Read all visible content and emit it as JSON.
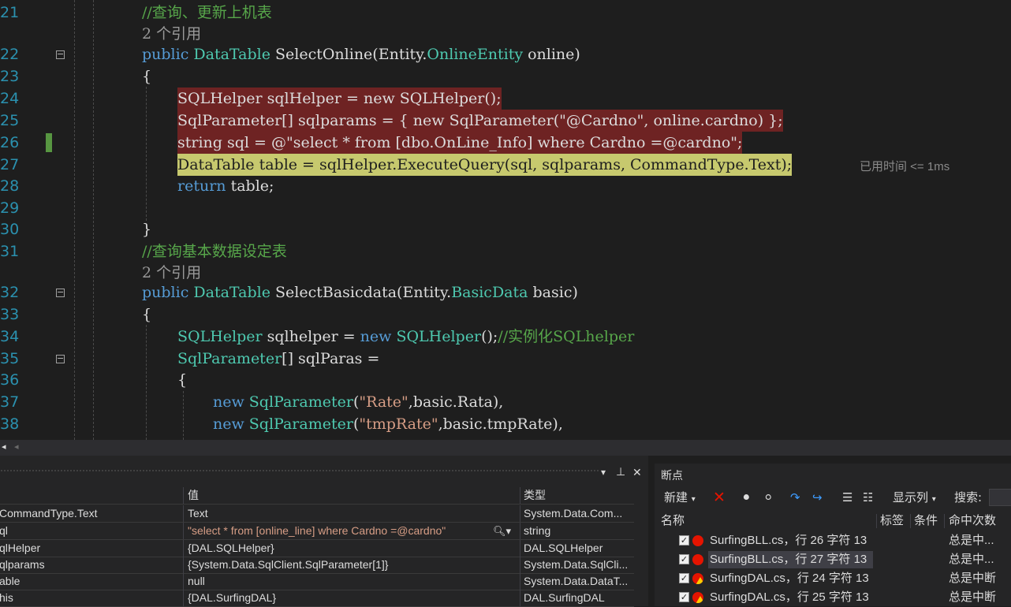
{
  "editor": {
    "lines": [
      {
        "n": "21"
      },
      {
        "n": "22"
      },
      {
        "n": "23"
      },
      {
        "n": "24"
      },
      {
        "n": "25"
      },
      {
        "n": "26"
      },
      {
        "n": "27"
      },
      {
        "n": "28"
      },
      {
        "n": "29"
      },
      {
        "n": "30"
      },
      {
        "n": "31"
      },
      {
        "n": "32"
      },
      {
        "n": "33"
      },
      {
        "n": "34"
      },
      {
        "n": "35"
      },
      {
        "n": "36"
      },
      {
        "n": "37"
      },
      {
        "n": "38"
      }
    ],
    "comment_21": "//查询、更新上机表",
    "refs_1": "2 个引用",
    "sig1": {
      "public": "public",
      "type": "DataTable",
      "name": " SelectOnline(Entity.",
      "param_type": "OnlineEntity",
      "param": " online)"
    },
    "brace_open": "{",
    "brace_close": "}",
    "l24": "SQLHelper sqlHelper = new SQLHelper();",
    "l25": "SqlParameter[] sqlparams = { new SqlParameter(\"@Cardno\", online.cardno) };",
    "l26": "string sql = @\"select * from [dbo.OnLine_Info] where Cardno =@cardno\";",
    "l27": "DataTable table = sqlHelper.ExecuteQuery(sql, sqlparams, CommandType.Text);",
    "elapsed": "已用时间 <= 1ms",
    "l28_kw": "return",
    "l28_rest": " table;",
    "comment_31": "//查询基本数据设定表",
    "refs_2": "2 个引用",
    "sig2": {
      "public": "public",
      "type": "DataTable",
      "name": " SelectBasicdata(Entity.",
      "param_type": "BasicData",
      "param": " basic)"
    },
    "l34": {
      "t1": "SQLHelper",
      "m1": " sqlhelper = ",
      "kw": "new",
      "t2": " SQLHelper",
      "m2": "();",
      "cm": "//实例化SQLhelper"
    },
    "l35": {
      "t": "SqlParameter",
      "m": "[] sqlParas ="
    },
    "l37": {
      "kw": "new",
      "t": " SqlParameter",
      "p1": "(",
      "s": "\"Rate\"",
      "p2": ",basic.Rata),"
    },
    "l38": {
      "kw": "new",
      "t": " SqlParameter",
      "p1": "(",
      "s": "\"tmpRate\"",
      "p2": ",basic.tmpRate),"
    }
  },
  "watch": {
    "columns": [
      "值",
      "类型"
    ],
    "rows": [
      {
        "name": "CommandType.Text",
        "value": "Text",
        "type": "System.Data.Com..."
      },
      {
        "name": "ql",
        "value": "\"select * from [online_line] where Cardno =@cardno\"",
        "type": "string"
      },
      {
        "name": "qlHelper",
        "value": "{DAL.SQLHelper}",
        "type": "DAL.SQLHelper"
      },
      {
        "name": "qlparams",
        "value": "{System.Data.SqlClient.SqlParameter[1]}",
        "type": "System.Data.SqlCli..."
      },
      {
        "name": "able",
        "value": "null",
        "type": "System.Data.DataT..."
      },
      {
        "name": "his",
        "value": "{DAL.SurfingDAL}",
        "type": "DAL.SurfingDAL"
      }
    ],
    "pin": "⊥",
    "close": "✕",
    "dropdown": "▾"
  },
  "breakpoints": {
    "title": "断点",
    "toolbar": {
      "new": "新建",
      "columns": "显示列",
      "search": "搜索:"
    },
    "columns": [
      "名称",
      "标签",
      "条件",
      "命中次数"
    ],
    "rows": [
      {
        "label": "SurfingBLL.cs，行 26 字符 13",
        "hit": "总是中...",
        "kind": "normal"
      },
      {
        "label": "SurfingBLL.cs，行 27 字符 13",
        "hit": "总是中...",
        "kind": "normal"
      },
      {
        "label": "SurfingDAL.cs，行 24 字符 13",
        "hit": "总是中断",
        "kind": "warn"
      },
      {
        "label": "SurfingDAL.cs，行 25 字符 13",
        "hit": "总是中断",
        "kind": "warn"
      }
    ]
  },
  "colors": {
    "accent": "#569cd6",
    "type": "#4ec9b0",
    "string": "#d69d85",
    "comment": "#57a64a",
    "breakpoint_line": "#6e2323",
    "current_line": "#c7c96e"
  }
}
